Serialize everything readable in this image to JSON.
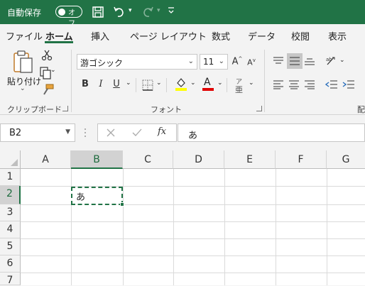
{
  "titlebar": {
    "autosave_label": "自動保存",
    "autosave_state": "オフ",
    "bg_color": "#217346",
    "icons": [
      "save-icon",
      "undo-icon",
      "redo-icon",
      "customize-qat-icon"
    ]
  },
  "tabs": [
    {
      "label": "ファイル",
      "active": false
    },
    {
      "label": "ホーム",
      "active": true
    },
    {
      "label": "挿入",
      "active": false
    },
    {
      "label": "ページ レイアウト",
      "active": false
    },
    {
      "label": "数式",
      "active": false
    },
    {
      "label": "データ",
      "active": false
    },
    {
      "label": "校閲",
      "active": false
    },
    {
      "label": "表示",
      "active": false
    }
  ],
  "ribbon": {
    "clipboard": {
      "paste_label": "貼り付け",
      "group_label": "クリップボード"
    },
    "font": {
      "font_name": "游ゴシック",
      "font_size": "11",
      "grow_label": "A",
      "shrink_label": "A",
      "bold": "B",
      "italic": "I",
      "underline": "U",
      "font_color_glyph": "A",
      "phonetic_glyph": "ア",
      "group_label": "フォント",
      "fill_color": "#ffff00",
      "font_color": "#e00000"
    },
    "alignment": {
      "group_label_partial": "配"
    }
  },
  "formula_bar": {
    "name_box": "B2",
    "formula": "あ",
    "fx_label": "fx"
  },
  "sheet": {
    "columns": [
      "A",
      "B",
      "C",
      "D",
      "E",
      "F",
      "G"
    ],
    "rows": [
      "1",
      "2",
      "3",
      "4",
      "5",
      "6",
      "7"
    ],
    "selected_column": "B",
    "selected_row": "2",
    "active_cell": {
      "ref": "B2",
      "value": "あ"
    }
  }
}
